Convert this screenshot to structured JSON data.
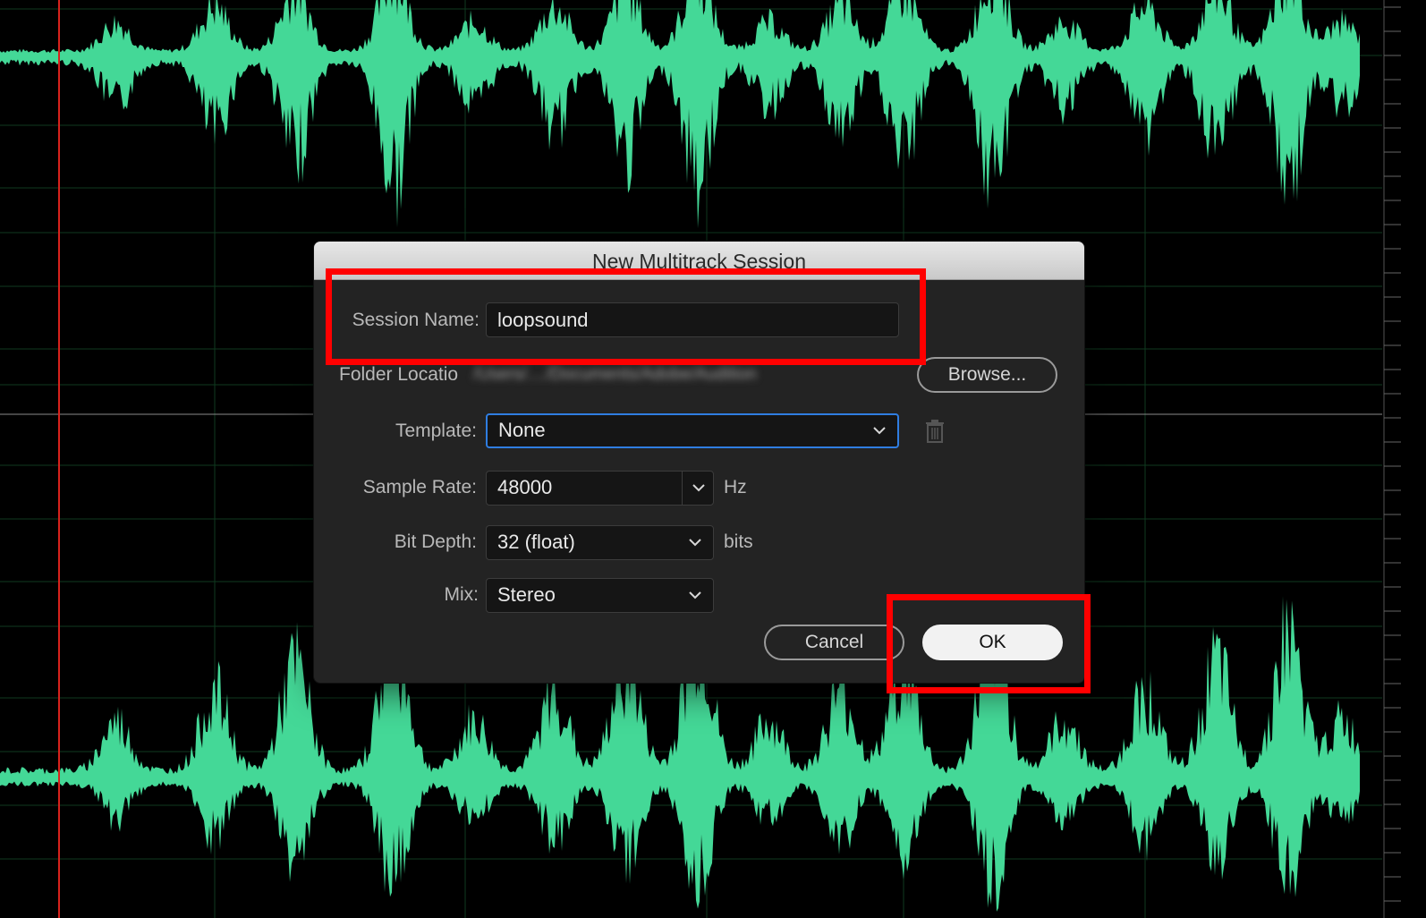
{
  "dialog": {
    "title": "New Multitrack Session",
    "session_name": {
      "label": "Session Name:",
      "value": "loopsound"
    },
    "folder_location": {
      "label": "Folder Locatio",
      "value": "/Users/..../Documents/Adobe/Audition",
      "browse_label": "Browse..."
    },
    "template": {
      "label": "Template:",
      "value": "None"
    },
    "sample_rate": {
      "label": "Sample Rate:",
      "value": "48000",
      "unit": "Hz"
    },
    "bit_depth": {
      "label": "Bit Depth:",
      "value": "32 (float)",
      "unit": "bits"
    },
    "mix": {
      "label": "Mix:",
      "value": "Stereo"
    },
    "cancel_label": "Cancel",
    "ok_label": "OK"
  },
  "icons": {
    "template_delete": "trash-icon",
    "dropdown": "chevron-down-icon"
  },
  "colors": {
    "waveform": "#44d897",
    "background": "#000000",
    "playhead": "#d9221c",
    "highlight": "#ff0000",
    "focus": "#2f7de1"
  }
}
